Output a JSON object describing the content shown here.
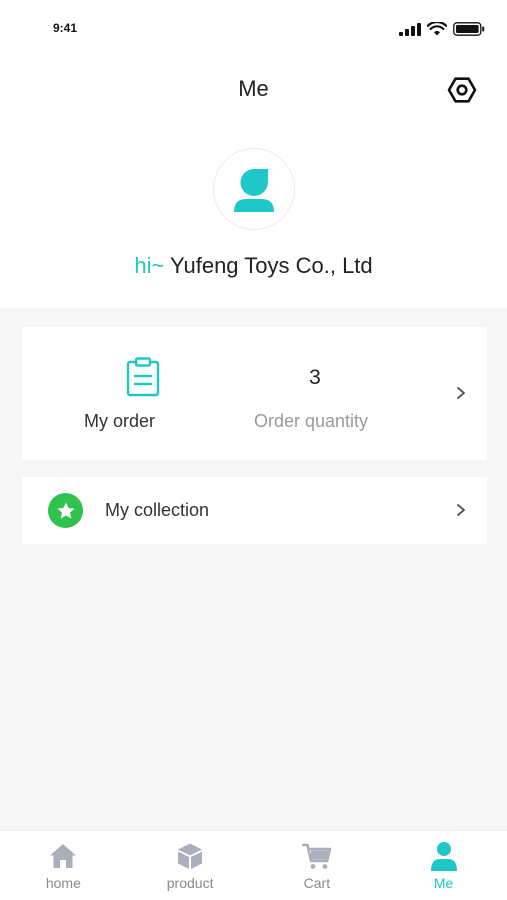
{
  "status_bar": {
    "time": "9:41"
  },
  "header": {
    "title": "Me"
  },
  "profile": {
    "greeting_prefix": "hi~",
    "company_name": "Yufeng Toys Co., Ltd"
  },
  "orders": {
    "my_order_label": "My order",
    "order_count": "3",
    "order_quantity_label": "Order quantity"
  },
  "collection": {
    "label": "My collection"
  },
  "tabs": [
    {
      "label": "home",
      "icon": "home-icon"
    },
    {
      "label": "product",
      "icon": "box-icon"
    },
    {
      "label": "Cart",
      "icon": "cart-icon"
    },
    {
      "label": "Me",
      "icon": "user-icon",
      "active": true
    }
  ],
  "colors": {
    "accent": "#1ec8c8",
    "star_green": "#2fc24f",
    "inactive_icon": "#a9b0bc"
  }
}
